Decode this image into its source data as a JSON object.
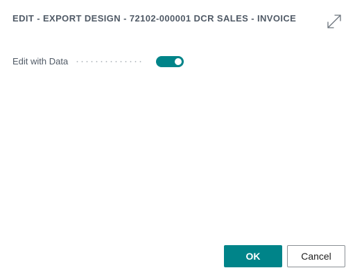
{
  "dialog": {
    "title": "EDIT - EXPORT DESIGN - 72102-000001 DCR SALES - INVOICE",
    "expand_icon": "expand-arrows-icon"
  },
  "fields": [
    {
      "label": "Edit with Data",
      "value": "on"
    }
  ],
  "buttons": {
    "ok_label": "OK",
    "cancel_label": "Cancel"
  },
  "colors": {
    "accent": "#008489",
    "title_text": "#505a66",
    "cancel_border": "#8a8f94"
  }
}
